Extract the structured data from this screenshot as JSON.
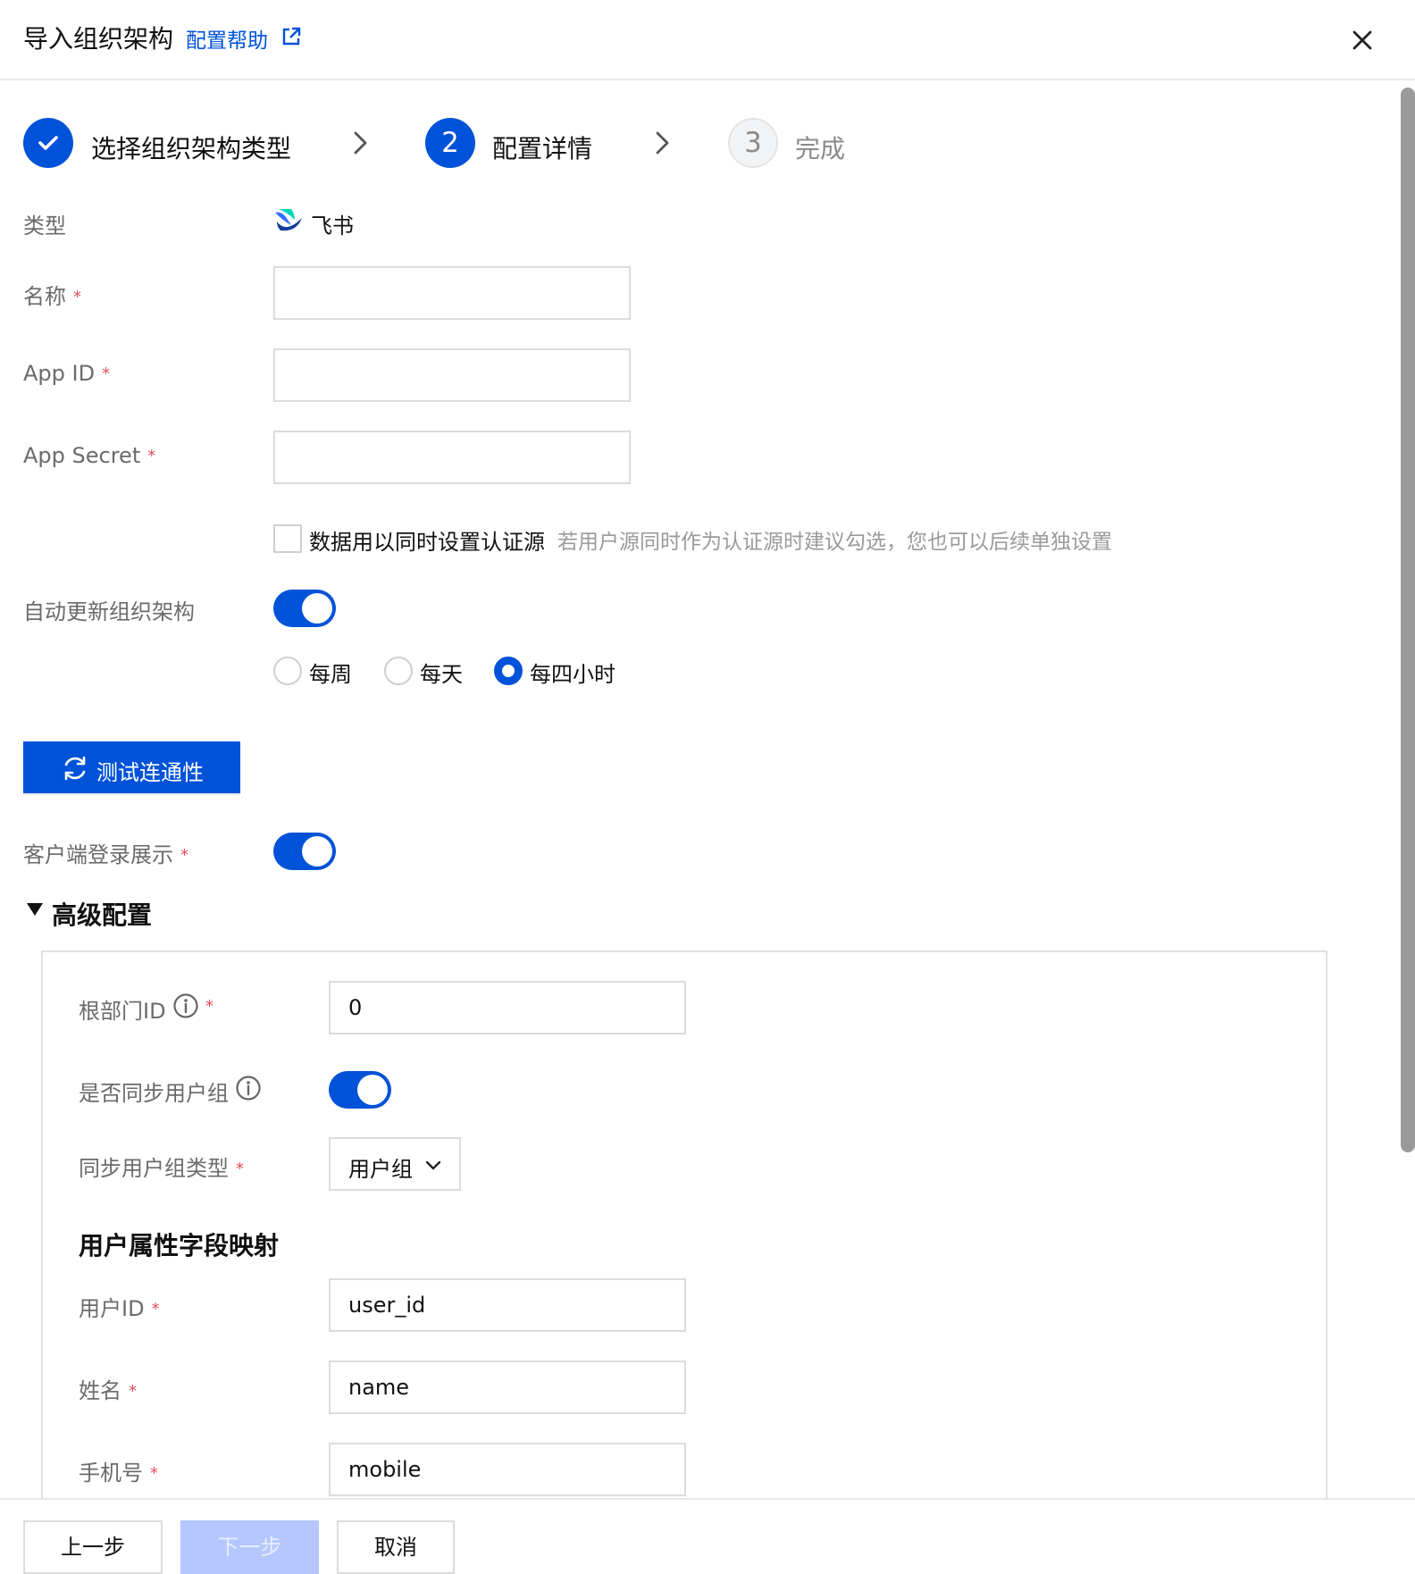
{
  "header": {
    "title": "导入组织架构",
    "help_link": "配置帮助"
  },
  "steps": [
    {
      "label": "选择组织架构类型",
      "status": "done"
    },
    {
      "number": "2",
      "label": "配置详情",
      "status": "active"
    },
    {
      "number": "3",
      "label": "完成",
      "status": "wait"
    }
  ],
  "form": {
    "type_label": "类型",
    "type_value": "飞书",
    "name_label": "名称",
    "name_value": "",
    "app_id_label": "App ID",
    "app_id_value": "",
    "app_secret_label": "App Secret",
    "app_secret_value": "",
    "auth_source_checkbox_label": "数据用以同时设置认证源",
    "auth_source_checked": false,
    "auth_source_hint": "若用户源同时作为认证源时建议勾选，您也可以后续单独设置",
    "auto_update_label": "自动更新组织架构",
    "auto_update_on": true,
    "frequency_options": [
      "每周",
      "每天",
      "每四小时"
    ],
    "frequency_selected": "每四小时",
    "test_button": "测试连通性",
    "client_login_label": "客户端登录展示",
    "client_login_on": true
  },
  "advanced": {
    "toggle_label": "高级配置",
    "expanded": true,
    "root_dept_label": "根部门ID",
    "root_dept_value": "0",
    "sync_group_label": "是否同步用户组",
    "sync_group_on": true,
    "sync_group_type_label": "同步用户组类型",
    "sync_group_type_value": "用户组",
    "mapping_title": "用户属性字段映射",
    "user_id_label": "用户ID",
    "user_id_value": "user_id",
    "name_label": "姓名",
    "name_value": "name",
    "mobile_label": "手机号",
    "mobile_value": "mobile"
  },
  "footer": {
    "prev": "上一步",
    "next": "下一步",
    "cancel": "取消"
  },
  "colors": {
    "primary": "#0052d9",
    "required": "#e34d59",
    "disabled_primary": "#b5c7ff"
  },
  "icons": [
    "external-link-icon",
    "close-icon",
    "check-icon",
    "chevron-right-icon",
    "feishu-logo",
    "refresh-icon",
    "info-icon",
    "chevron-down-icon",
    "caret-down-icon"
  ]
}
